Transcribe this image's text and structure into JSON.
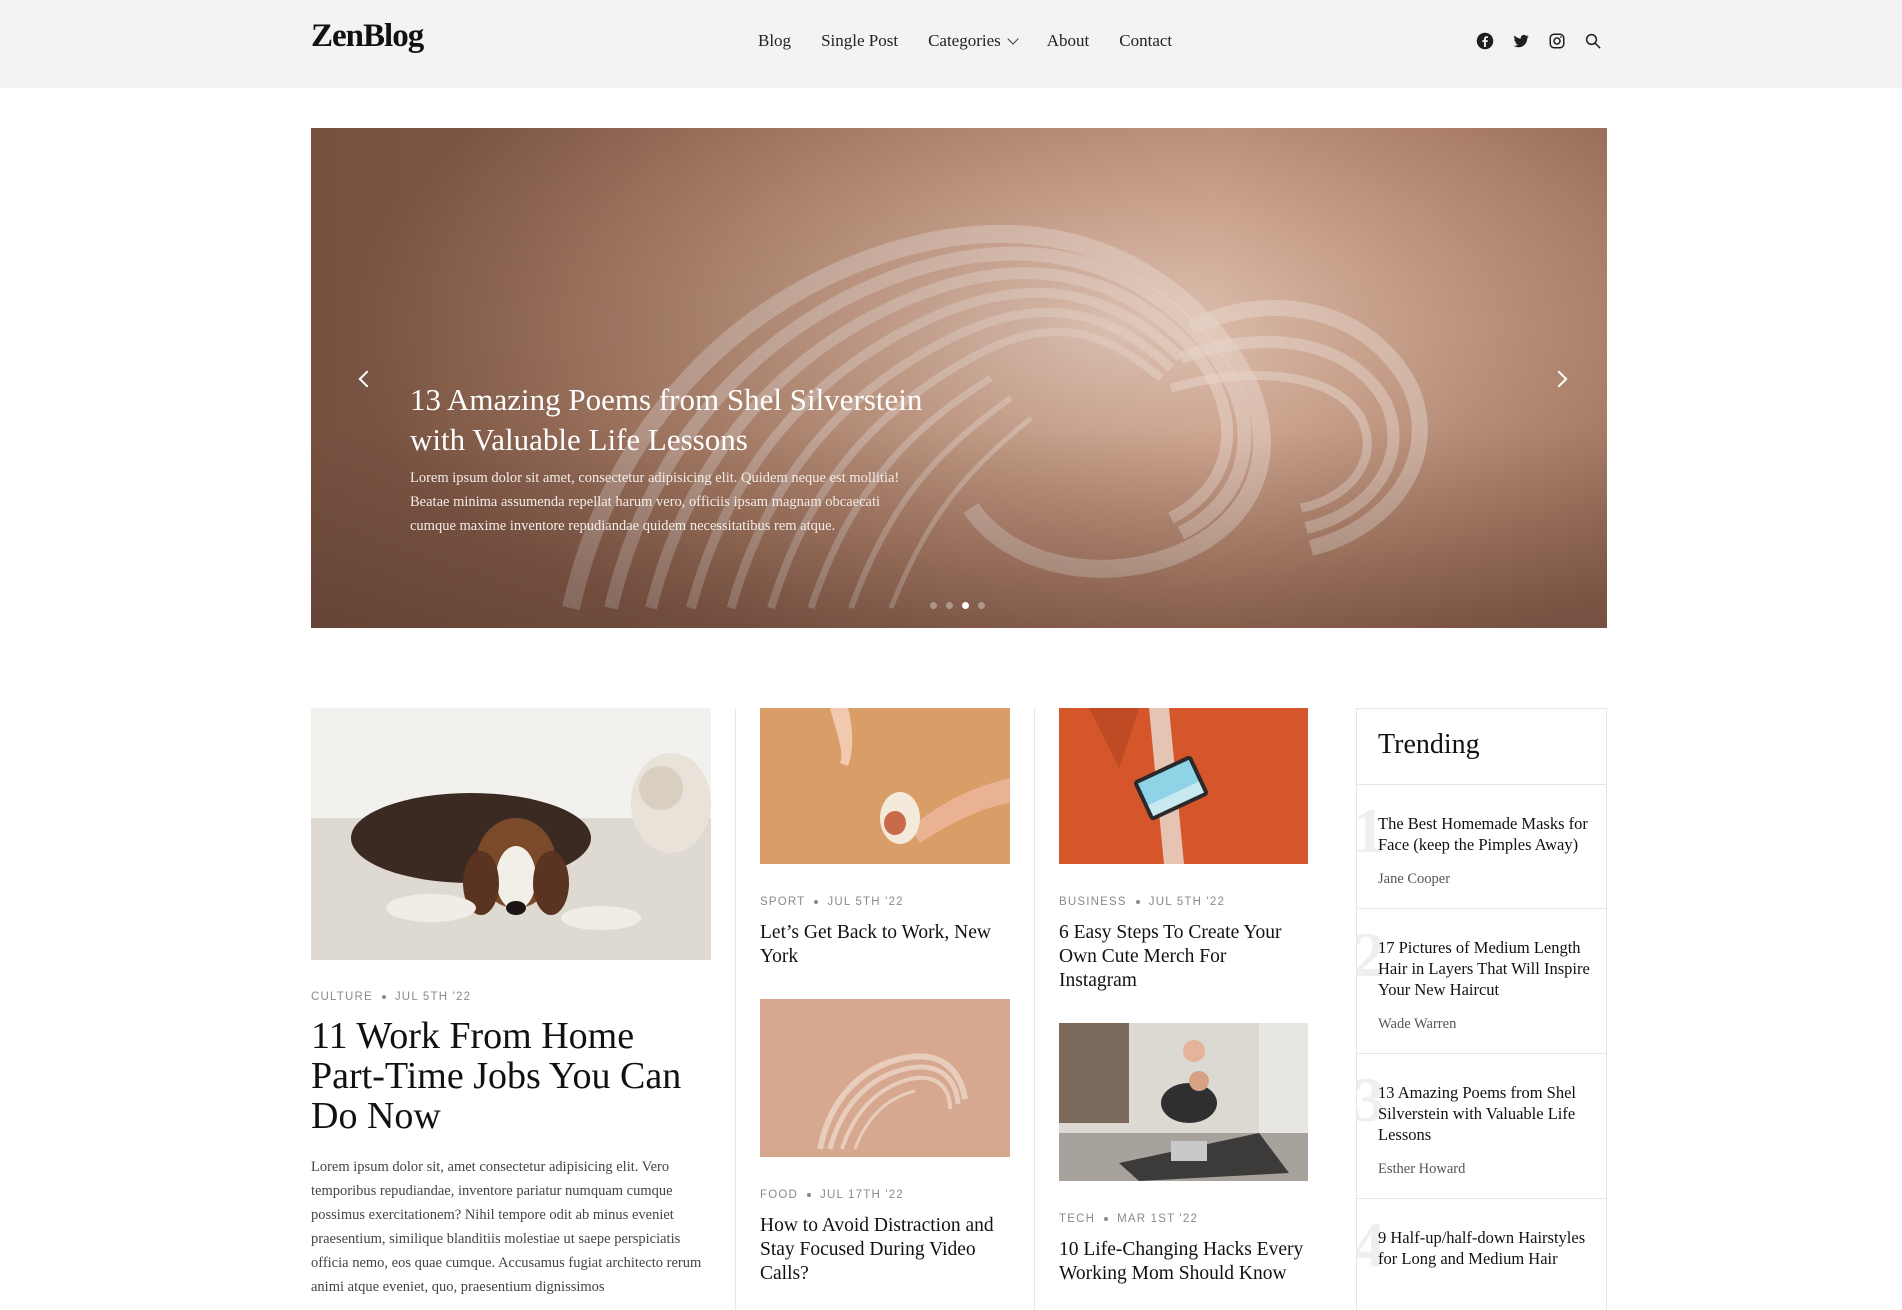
{
  "header": {
    "logo": "ZenBlog",
    "nav": [
      {
        "label": "Blog"
      },
      {
        "label": "Single Post"
      },
      {
        "label": "Categories"
      },
      {
        "label": "About"
      },
      {
        "label": "Contact"
      }
    ],
    "icons": [
      "facebook-icon",
      "twitter-icon",
      "instagram-icon",
      "search-icon"
    ]
  },
  "hero": {
    "title": "13 Amazing Poems from Shel Silverstein with Valuable Life Lessons",
    "excerpt": "Lorem ipsum dolor sit amet, consectetur adipisicing elit. Quidem neque est mollitia! Beatae minima assumenda repellat harum vero, officiis ipsam magnam obcaecati cumque maxime inventore repudiandae quidem necessitatibus rem atque.",
    "slides": 4,
    "active_slide": 3
  },
  "featured": {
    "category": "Culture",
    "date": "Jul 5th '22",
    "title": "11 Work From Home Part-Time Jobs You Can Do Now",
    "excerpt": "Lorem ipsum dolor sit, amet consectetur adipisicing elit. Vero temporibus repudiandae, inventore pariatur numquam cumque possimus exercitationem? Nihil tempore odit ab minus eveniet praesentium, similique blanditiis molestiae ut saepe perspiciatis officia nemo, eos quae cumque. Accusamus fugiat architecto rerum animi atque eveniet, quo, praesentium dignissimos"
  },
  "posts": [
    {
      "category": "Sport",
      "date": "Jul 5th '22",
      "title": "Let’s Get Back to Work, New York"
    },
    {
      "category": "Food",
      "date": "Jul 17th '22",
      "title": "How to Avoid Distraction and Stay Focused During Video Calls?"
    },
    {
      "category": "Business",
      "date": "Jul 5th '22",
      "title": "6 Easy Steps To Create Your Own Cute Merch For Instagram"
    },
    {
      "category": "Tech",
      "date": "Mar 1st '22",
      "title": "10 Life-Changing Hacks Every Working Mom Should Know"
    }
  ],
  "trending": {
    "heading": "Trending",
    "items": [
      {
        "num": "1",
        "title": "The Best Homemade Masks for Face (keep the Pimples Away)",
        "author": "Jane Cooper"
      },
      {
        "num": "2",
        "title": "17 Pictures of Medium Length Hair in Layers That Will Inspire Your New Haircut",
        "author": "Wade Warren"
      },
      {
        "num": "3",
        "title": "13 Amazing Poems from Shel Silverstein with Valuable Life Lessons",
        "author": "Esther Howard"
      },
      {
        "num": "4",
        "title": "9 Half-up/half-down Hairstyles for Long and Medium Hair",
        "author": ""
      }
    ]
  }
}
